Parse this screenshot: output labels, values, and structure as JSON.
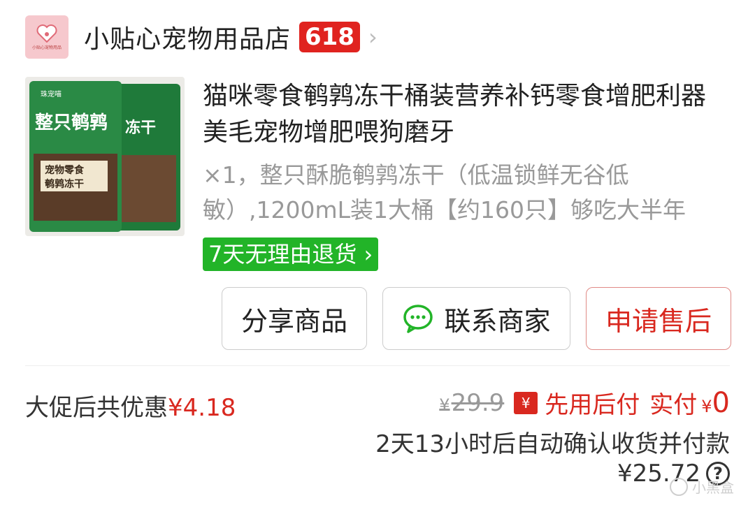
{
  "store": {
    "name": "小贴心宠物用品店",
    "badge": "618",
    "logo_text": "小贴心宠物用品",
    "logo_icon": "heart-paw-icon"
  },
  "product": {
    "title": "猫咪零食鹌鹑冻干桶装营养补钙零食增肥利器美毛宠物增肥喂狗磨牙",
    "spec": "×1，整只酥脆鹌鹑冻干（低温锁鲜无谷低敏）,1200mL装1大桶【约160只】够吃大半年",
    "return_policy": "7天无理由退货",
    "image": {
      "headline": "整只鹌鹑",
      "side_text": "冻干",
      "label1": "宠物零食",
      "label2": "鹌鹑冻干",
      "brand": "珠宠喵"
    }
  },
  "actions": {
    "share": "分享商品",
    "contact": "联系商家",
    "after_sale": "申请售后"
  },
  "pricing": {
    "promo_label": "大促后共优惠",
    "promo_amount": "¥4.18",
    "original_yen": "¥",
    "original_price": "29.9",
    "bnpl_icon": "¥",
    "bnpl_text": "先用后付",
    "actual_label": "实付",
    "actual_yen": "¥",
    "actual_value": "0",
    "confirm_text": "2天13小时后自动确认收货并付款",
    "final_amount": "¥25.72",
    "help_icon": "?"
  },
  "colors": {
    "accent_red": "#d9281f",
    "return_green": "#22b428",
    "badge_red": "#e0231f"
  },
  "watermark": "小黑盒"
}
